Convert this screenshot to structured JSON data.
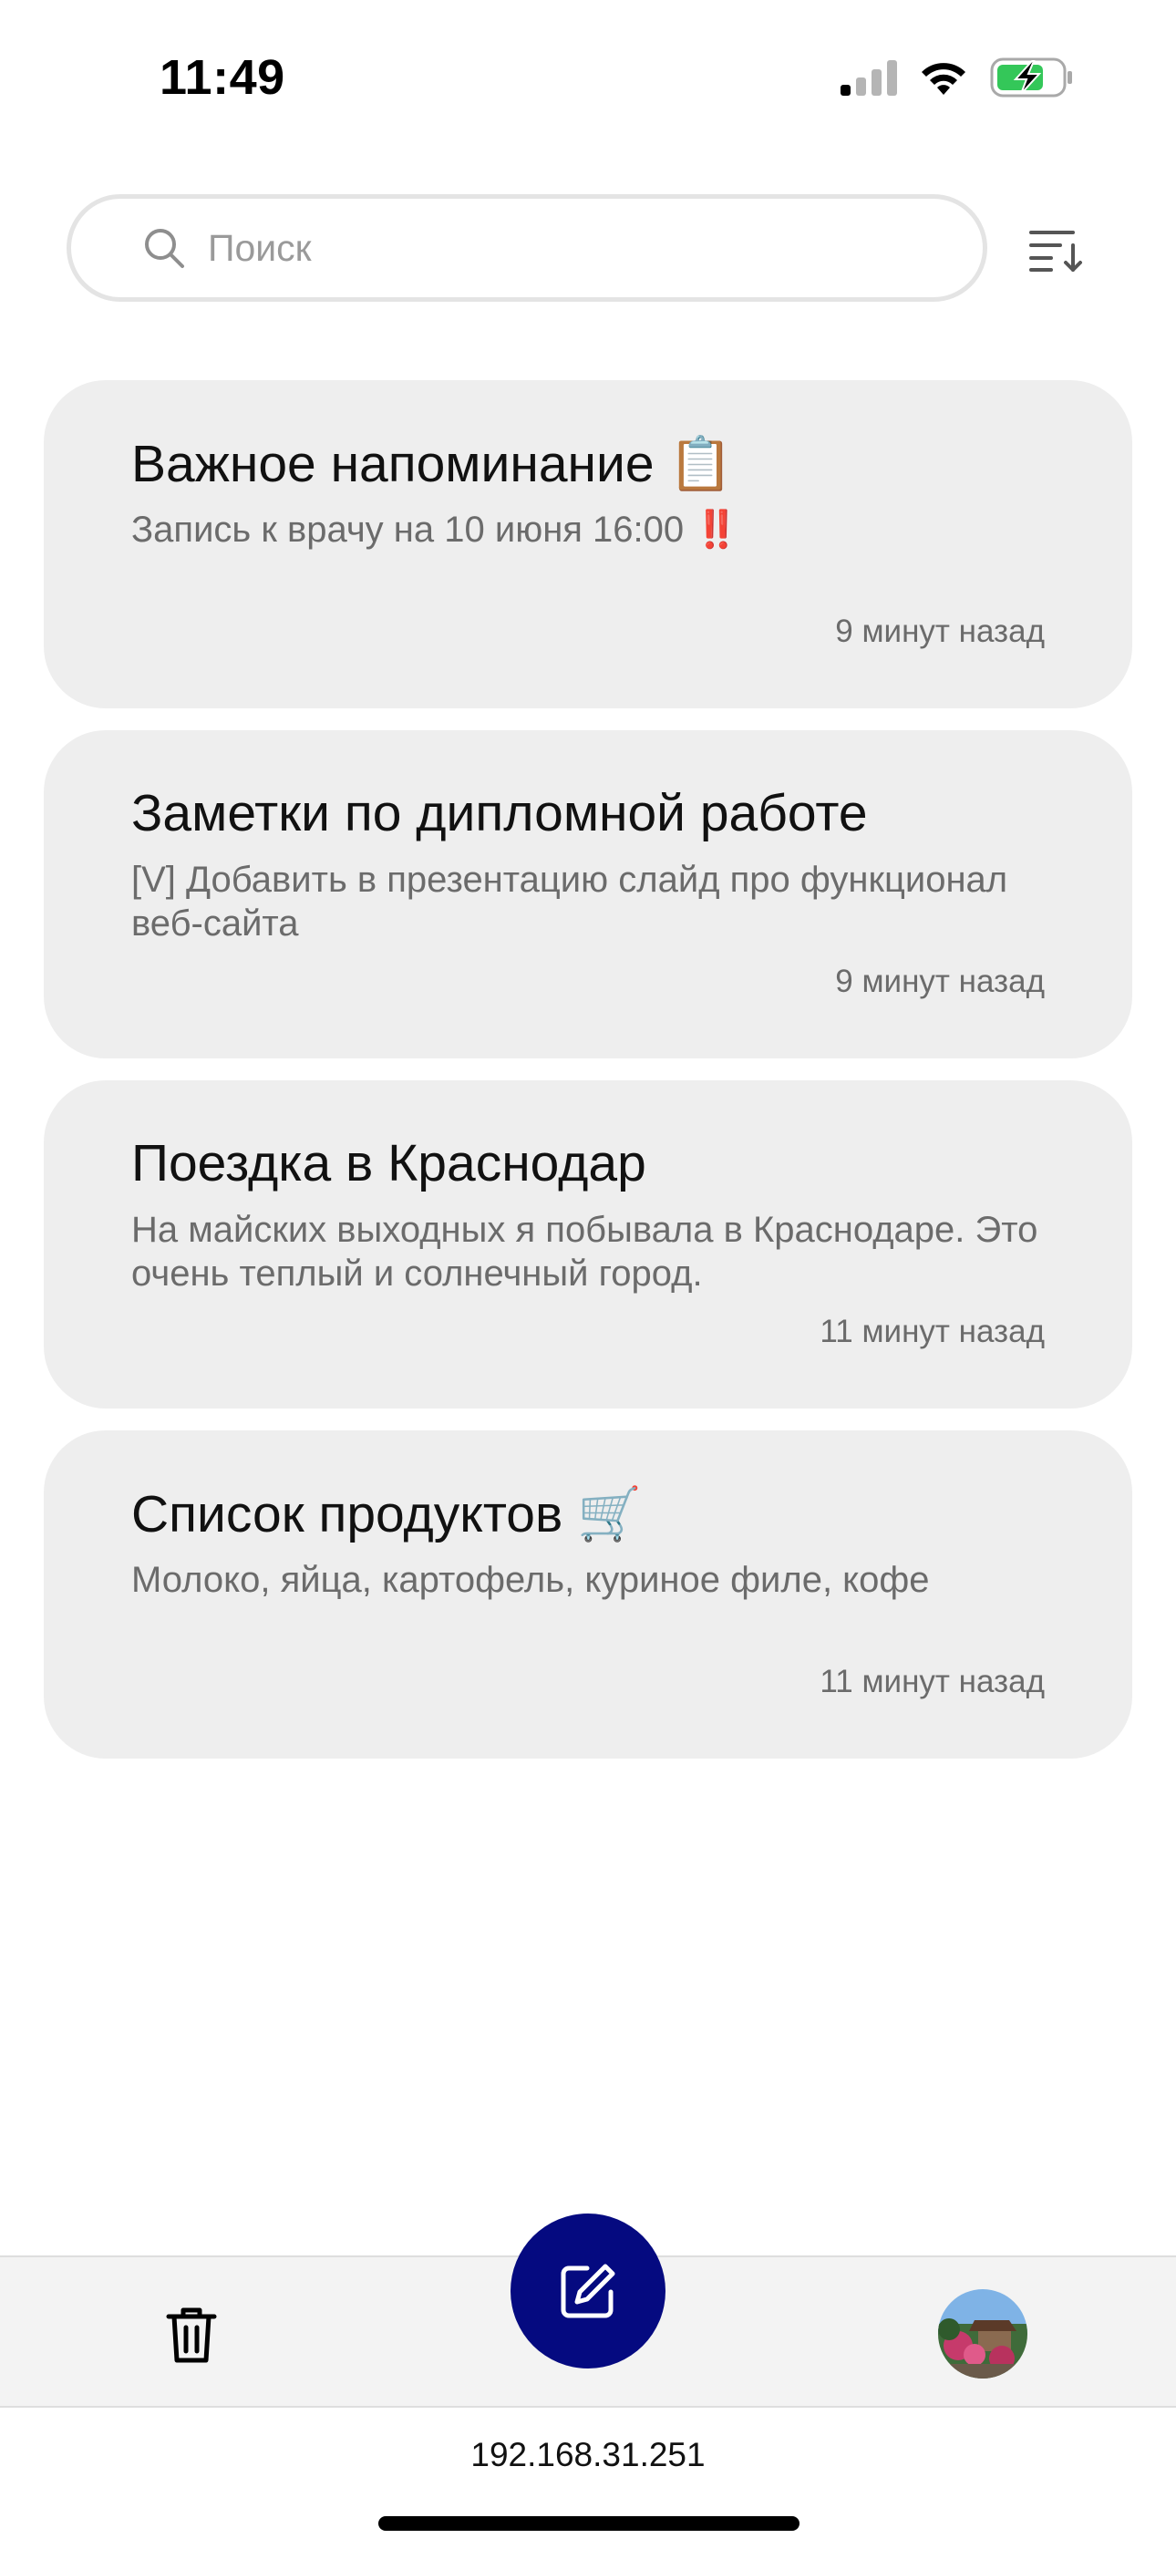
{
  "status_bar": {
    "time": "11:49"
  },
  "search": {
    "placeholder": "Поиск",
    "value": ""
  },
  "notes": [
    {
      "title": "Важное напоминание 📋",
      "body": "Запись к врачу на 10 июня 16:00 ‼️",
      "time": "9 минут назад"
    },
    {
      "title": "Заметки по дипломной работе",
      "body": "[V] Добавить в презентацию слайд про функционал веб-сайта",
      "time": "9 минут назад"
    },
    {
      "title": "Поездка в Краснодар",
      "body": "На майских выходных я побывала в Краснодаре. Это очень теплый и солнечный город.",
      "time": "11 минут назад"
    },
    {
      "title": "Список продуктов 🛒",
      "body": "Молоко, яйца, картофель, куриное филе, кофе",
      "time": "11 минут назад"
    }
  ],
  "url": "192.168.31.251",
  "colors": {
    "accent": "#050a80",
    "card": "#eeeeee",
    "battery": "#34c759"
  },
  "icons": {
    "search": "magnifier",
    "sort": "sort-descending",
    "trash": "trash-can",
    "compose": "pencil-square"
  }
}
